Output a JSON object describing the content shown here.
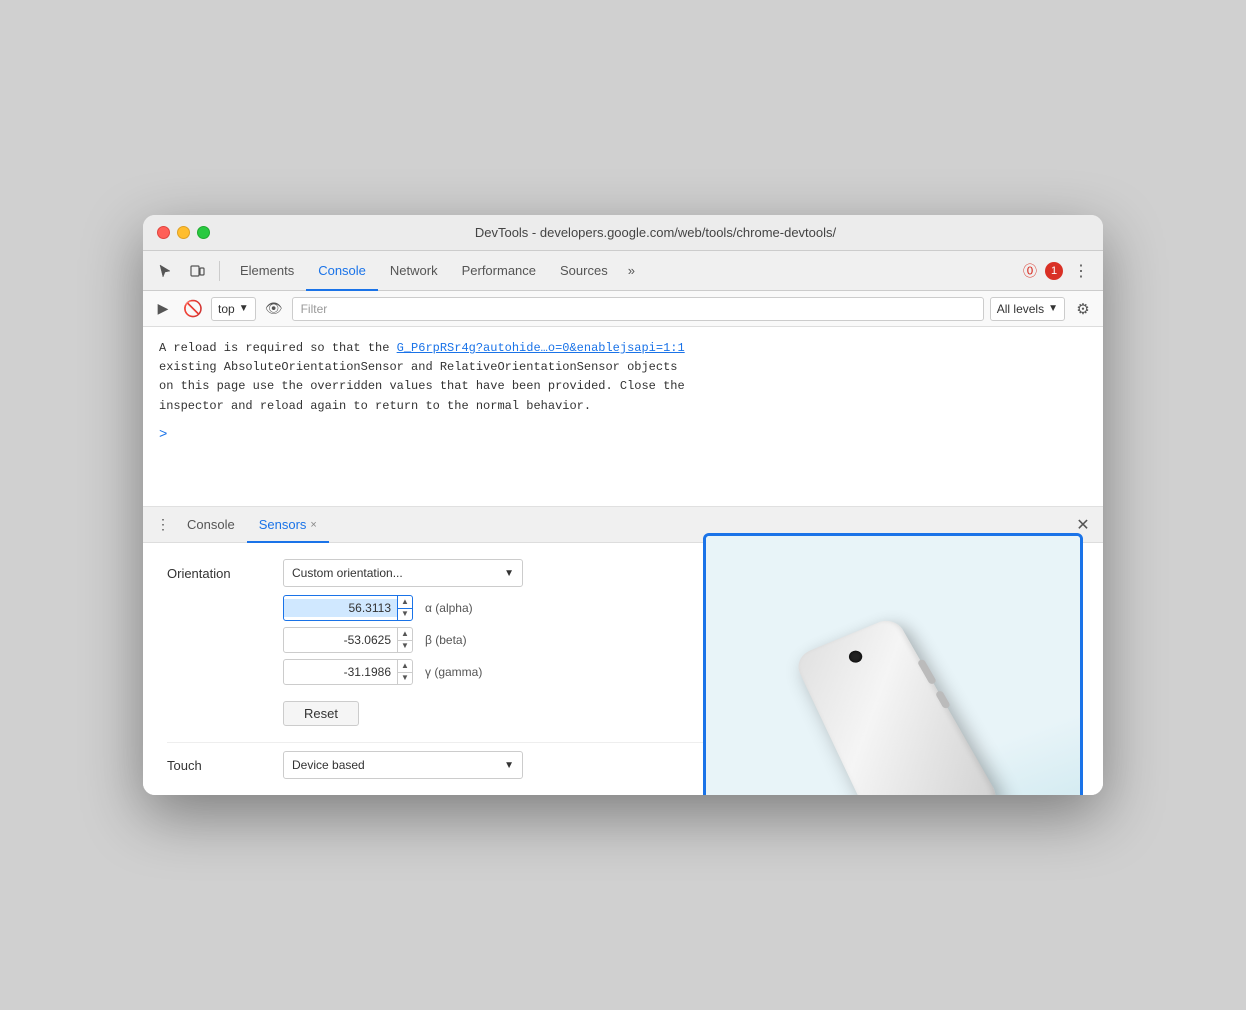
{
  "window": {
    "title": "DevTools - developers.google.com/web/tools/chrome-devtools/"
  },
  "toolbar": {
    "tabs": [
      {
        "id": "elements",
        "label": "Elements",
        "active": false
      },
      {
        "id": "console",
        "label": "Console",
        "active": true
      },
      {
        "id": "network",
        "label": "Network",
        "active": false
      },
      {
        "id": "performance",
        "label": "Performance",
        "active": false
      },
      {
        "id": "sources",
        "label": "Sources",
        "active": false
      }
    ],
    "more_label": "»",
    "error_count": "1",
    "menu_dots": "⋮"
  },
  "filter_bar": {
    "context_value": "top",
    "filter_placeholder": "Filter",
    "levels_label": "All levels"
  },
  "console_output": {
    "message_part1": "A reload is required so that the ",
    "link_text": "G_P6rpRSr4g?autohide…o=0&enablejsapi=1:1",
    "message_part2": "existing AbsoluteOrientationSensor and RelativeOrientationSensor objects\non this page use the overridden values that have been provided. Close the\ninspector and reload again to return to the normal behavior.",
    "prompt": ">"
  },
  "bottom_panel": {
    "tabs": [
      {
        "id": "console",
        "label": "Console",
        "active": false,
        "closeable": false
      },
      {
        "id": "sensors",
        "label": "Sensors",
        "active": true,
        "closeable": true
      }
    ],
    "close_label": "✕"
  },
  "sensors": {
    "orientation_label": "Orientation",
    "dropdown_value": "Custom orientation...",
    "alpha_value": "56.3113",
    "alpha_label": "α (alpha)",
    "beta_value": "-53.0625",
    "beta_label": "β (beta)",
    "gamma_value": "-31.1986",
    "gamma_label": "γ (gamma)",
    "reset_label": "Reset",
    "touch_label": "Touch",
    "touch_dropdown": "Device based"
  }
}
